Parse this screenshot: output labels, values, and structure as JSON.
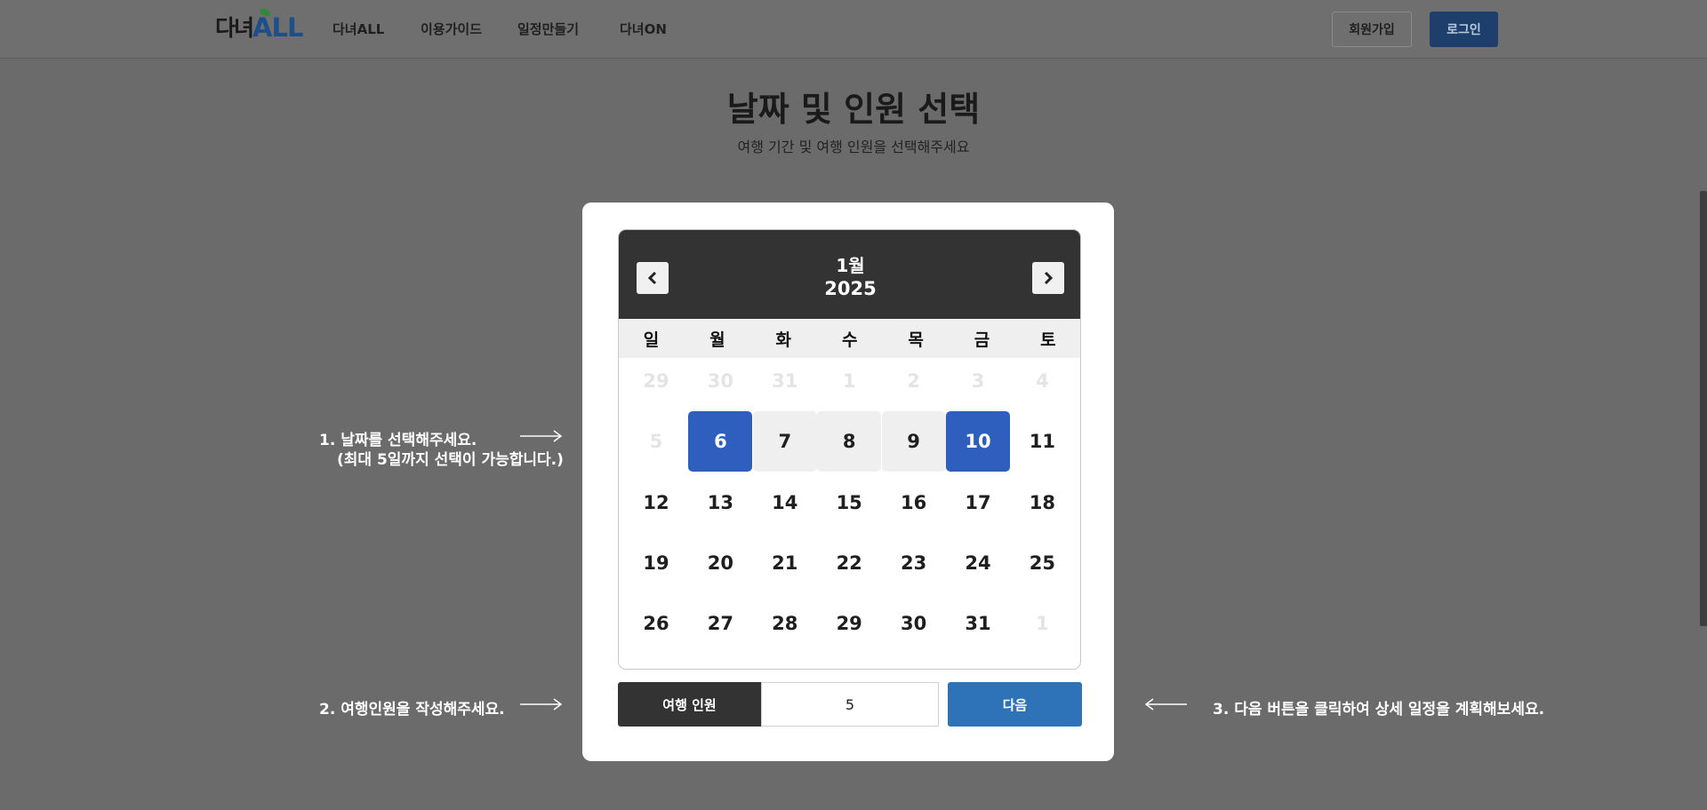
{
  "header": {
    "logo_part1": "다녀",
    "logo_part2": "ALL",
    "nav": [
      "다녀ALL",
      "이용가이드",
      "일정만들기",
      "다녀ON"
    ],
    "signup_label": "회원가입",
    "login_label": "로그인"
  },
  "page": {
    "title": "날짜 및 인원 선택",
    "subtitle": "여행 기간 및 여행 인원을 선택해주세요"
  },
  "calendar": {
    "month": "1월",
    "year": "2025",
    "weekdays": [
      "일",
      "월",
      "화",
      "수",
      "목",
      "금",
      "토"
    ],
    "days": [
      "29",
      "30",
      "31",
      "1",
      "2",
      "3",
      "4",
      "5",
      "6",
      "7",
      "8",
      "9",
      "10",
      "11",
      "12",
      "13",
      "14",
      "15",
      "16",
      "17",
      "18",
      "19",
      "20",
      "21",
      "22",
      "23",
      "24",
      "25",
      "26",
      "27",
      "28",
      "29",
      "30",
      "31",
      "1"
    ],
    "selected_start": "6",
    "selected_end": "10"
  },
  "people": {
    "label": "여행 인원",
    "value": "5",
    "next_label": "다음"
  },
  "guides": {
    "step1_line1": "1. 날짜를 선택해주세요.",
    "step1_line2": "(최대 5일까지 선택이 가능합니다.)",
    "step2": "2. 여행인원을 작성해주세요.",
    "step3": "3. 다음 버튼을 클릭하여 상세 일정을 계획해보세요."
  },
  "colors": {
    "overlay": "#6b6b6b",
    "selected": "#2f5fbe",
    "range": "#efefef",
    "calendar_header": "#333333",
    "next_button": "#2e73b8",
    "login_button": "#1e3f6b"
  }
}
